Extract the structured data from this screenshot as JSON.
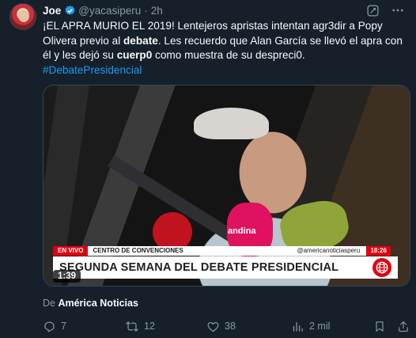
{
  "tweet": {
    "author_name": "Joe",
    "handle": "@yacasiperu",
    "separator": "·",
    "time": "2h",
    "text_part1": "¡EL APRA MURIO EL 2019! Lentejeros apristas intentan agr3dir a Popy Olivera previo al ",
    "text_bold1": "debate",
    "text_part2": ". Les recuerdo que Alan García se llevó el apra con él y les dejó su ",
    "text_bold2": "cuerp0",
    "text_part3": " como muestra de su despreci0.",
    "hashtag": "#DebatePresidencial"
  },
  "media": {
    "mic_label": "andina",
    "live_tag": "EN VIVO",
    "location": "CENTRO DE CONVENCIONES",
    "social": "@americanoticiasperu",
    "clock": "18:26",
    "headline": "SEGUNDA SEMANA DEL DEBATE PRESIDENCIAL",
    "duration": "1:39"
  },
  "source": {
    "prefix": "De",
    "name": "América Noticias"
  },
  "actions": {
    "replies": "7",
    "reposts": "12",
    "likes": "38",
    "views": "2 mil"
  },
  "icons": [
    "verified-badge-icon",
    "grok-icon",
    "more-icon",
    "reply-icon",
    "repost-icon",
    "like-icon",
    "views-icon",
    "bookmark-icon",
    "share-icon"
  ],
  "colors": {
    "background": "#15202b",
    "accent": "#1d9bf0",
    "muted": "#8b98a5",
    "news_red": "#e3000f"
  }
}
